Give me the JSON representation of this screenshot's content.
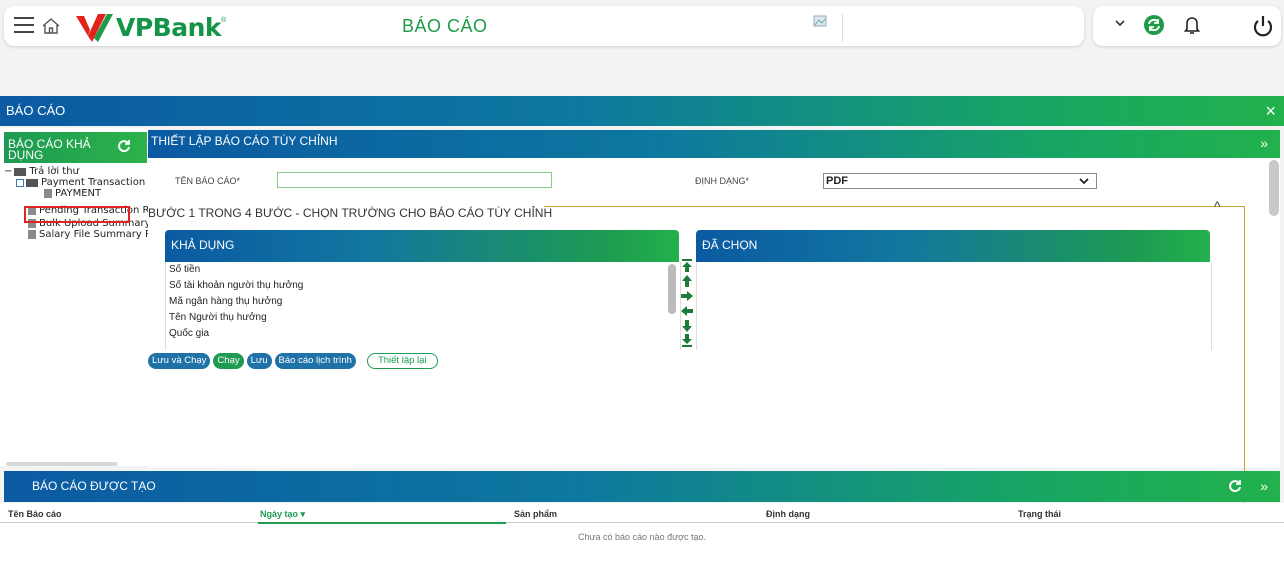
{
  "header": {
    "brand": "VPBank",
    "title": "BÁO CÁO"
  },
  "report_bar": {
    "title": "BÁO CÁO",
    "close": "×"
  },
  "left_panel": {
    "title_line1": "BÁO CÁO KHẢ",
    "title_line2": "DỤNG",
    "tree": {
      "root": "Trả lời thư",
      "group": "Payment Transaction R",
      "child": "PAYMENT",
      "items": [
        "Pending Transaction Re",
        "Bulk Upload Summary I",
        "Salary File Summary Re"
      ]
    }
  },
  "custom": {
    "title": "THIẾT LẬP BÁO CÁO TÙY CHỈNH",
    "expand": "»",
    "name_label": "TÊN BÁO CÁO*",
    "name_value": "",
    "format_label": "ĐỊNH DẠNG*",
    "format_value": "PDF",
    "step": "BƯỚC 1 TRONG 4 BƯỚC - CHỌN TRƯỜNG CHO BÁO CÁO TÙY CHỈNH",
    "available_title": "KHẢ DỤNG",
    "selected_title": "ĐÃ CHỌN",
    "available_items": [
      "Số tiền",
      "Số tài khoản người thụ hưởng",
      "Mã ngân hàng thụ hưởng",
      "Tên Người thụ hưởng",
      "Quốc gia"
    ],
    "buttons": {
      "save_run": "Lưu và Chạy",
      "run": "Chạy",
      "save": "Lưu",
      "schedule": "Báo cáo lịch trình",
      "reset": "Thiết lập lại"
    }
  },
  "generated": {
    "title": "BÁO CÁO ĐƯỢC TẠO",
    "expand": "»",
    "columns": [
      "Tên Báo cáo",
      "Ngày tạo ▾",
      "Sản phẩm",
      "Định dạng",
      "Trạng thái"
    ],
    "empty_text": "Chưa có báo cáo nào được tạo."
  }
}
